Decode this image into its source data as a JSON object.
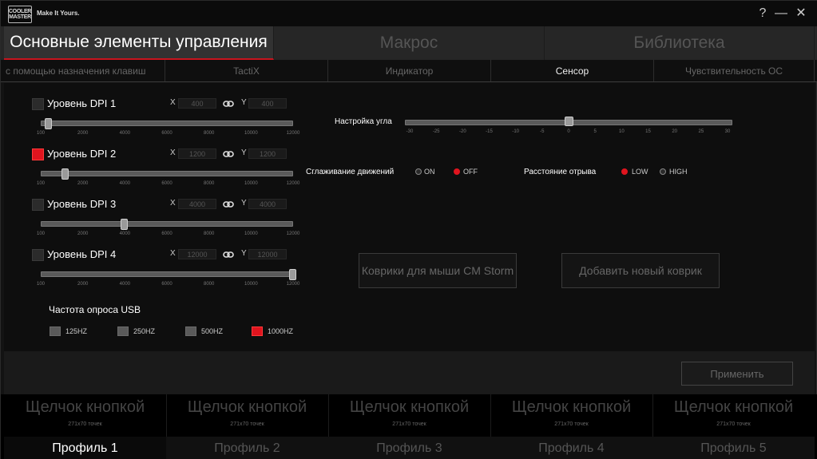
{
  "window": {
    "logo_text": "COOLER MASTER",
    "tagline": "Make It Yours.",
    "help_label": "?",
    "minimize_label": "—",
    "close_label": "✕"
  },
  "main_tabs": [
    {
      "label": "Основные элементы управления",
      "active": true
    },
    {
      "label": "Макрос",
      "active": false
    },
    {
      "label": "Библиотека",
      "active": false
    }
  ],
  "sub_tabs": [
    {
      "label": "с помощью назначения клавиш",
      "active": false
    },
    {
      "label": "TactiX",
      "active": false
    },
    {
      "label": "Индикатор",
      "active": false
    },
    {
      "label": "Сенсор",
      "active": true
    },
    {
      "label": "Чувствительность ОС",
      "active": false
    }
  ],
  "dpi_levels": [
    {
      "label": "Уровень DPI 1",
      "checked": false,
      "x_label": "X",
      "x_value": "400",
      "y_label": "Y",
      "y_value": "400",
      "slider_value": 400
    },
    {
      "label": "Уровень DPI 2",
      "checked": true,
      "x_label": "X",
      "x_value": "1200",
      "y_label": "Y",
      "y_value": "1200",
      "slider_value": 1200
    },
    {
      "label": "Уровень DPI 3",
      "checked": false,
      "x_label": "X",
      "x_value": "4000",
      "y_label": "Y",
      "y_value": "4000",
      "slider_value": 4000
    },
    {
      "label": "Уровень DPI 4",
      "checked": false,
      "x_label": "X",
      "x_value": "12000",
      "y_label": "Y",
      "y_value": "12000",
      "slider_value": 12000
    }
  ],
  "dpi_ticks": [
    "100",
    "2000",
    "4000",
    "6000",
    "8000",
    "10000",
    "12000"
  ],
  "usb": {
    "title": "Частота опроса USB",
    "options": [
      {
        "label": "125HZ",
        "selected": false
      },
      {
        "label": "250HZ",
        "selected": false
      },
      {
        "label": "500HZ",
        "selected": false
      },
      {
        "label": "1000HZ",
        "selected": true
      }
    ]
  },
  "angle": {
    "label": "Настройка угла",
    "value": 0,
    "ticks": [
      "-30",
      "-25",
      "-20",
      "-15",
      "-10",
      "-5",
      "0",
      "5",
      "10",
      "15",
      "20",
      "25",
      "30"
    ]
  },
  "smoothing": {
    "label": "Сглаживание движений",
    "on_label": "ON",
    "off_label": "OFF",
    "value": "OFF"
  },
  "lift_off": {
    "label": "Расстояние отрыва",
    "low_label": "LOW",
    "high_label": "HIGH",
    "value": "LOW"
  },
  "buttons": {
    "mousepads": "Коврики для мыши CM Storm",
    "add_pad": "Добавить новый коврик",
    "apply": "Применить"
  },
  "profiles": [
    {
      "button_text": "Щелчок кнопкой",
      "size": "271x70 точек",
      "name": "Профиль 1",
      "active": true
    },
    {
      "button_text": "Щелчок кнопкой",
      "size": "271x70 точек",
      "name": "Профиль 2",
      "active": false
    },
    {
      "button_text": "Щелчок кнопкой",
      "size": "271x70 точек",
      "name": "Профиль 3",
      "active": false
    },
    {
      "button_text": "Щелчок кнопкой",
      "size": "271x70 точек",
      "name": "Профиль 4",
      "active": false
    },
    {
      "button_text": "Щелчок кнопкой",
      "size": "271x70 точек",
      "name": "Профиль 5",
      "active": false
    }
  ],
  "colors": {
    "accent": "#e0141e",
    "background": "#0e0e0e"
  }
}
